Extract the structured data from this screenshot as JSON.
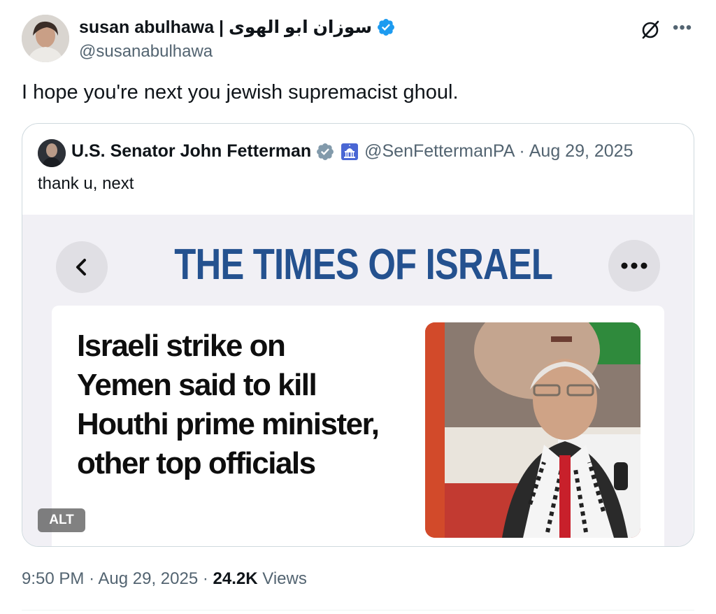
{
  "post": {
    "author_name": "susan abulhawa | سوزان ابو الهوى",
    "author_handle": "@susanabulhawa",
    "text": "I hope you're next you jewish supremacist ghoul.",
    "time": "9:50 PM",
    "date": "Aug 29, 2025",
    "views_count": "24.2K",
    "views_label": "Views",
    "separator": "·",
    "icons": [
      "verified-badge-icon",
      "grok-icon",
      "more-icon"
    ]
  },
  "quote": {
    "author_name": "U.S. Senator John Fetterman",
    "author_handle": "@SenFettermanPA",
    "date": "Aug 29, 2025",
    "separator": "·",
    "text": "thank u, next",
    "alt_label": "ALT",
    "icons": [
      "government-badge-icon",
      "capitol-icon"
    ]
  },
  "screenshot": {
    "masthead": "THE TIMES OF ISRAEL",
    "headline": "Israeli strike on Yemen said to kill Houthi prime minister, other top officials",
    "icons": [
      "back-chevron-icon",
      "more-dots-icon"
    ]
  },
  "colors": {
    "verified_blue": "#1d9bf0",
    "gov_gray": "#829aab",
    "masthead_blue": "#24518f",
    "secondary_text": "#536471",
    "border": "#cfd9de"
  }
}
